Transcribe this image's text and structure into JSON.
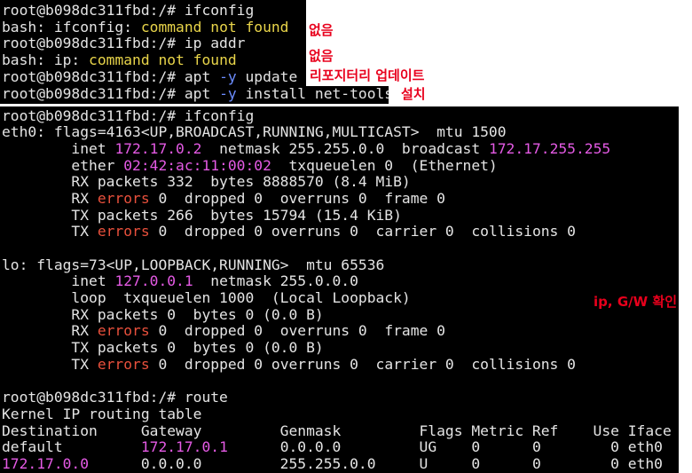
{
  "colors": {
    "terminal_bg": "#000000",
    "text": "#e4e4e4",
    "yellow": "#e9d54a",
    "magenta": "#e45ae4",
    "red": "#e8503c",
    "blue": "#6b8cff",
    "annotation": "#e8001c",
    "page_bg": "#ffffff"
  },
  "blocks": {
    "top": [
      [
        {
          "t": "root@b098dc311fbd:/# ifconfig"
        }
      ],
      [
        {
          "t": "bash: ifconfig: "
        },
        {
          "t": "command not found",
          "c": "yellow"
        }
      ],
      [
        {
          "t": "root@b098dc311fbd:/# ip addr"
        }
      ],
      [
        {
          "t": "bash: ip: "
        },
        {
          "t": "command not found",
          "c": "yellow"
        }
      ],
      [
        {
          "t": "root@b098dc311fbd:/# apt "
        },
        {
          "t": "-y",
          "c": "blue"
        },
        {
          "t": " update"
        }
      ]
    ],
    "install": [
      [
        {
          "t": "root@b098dc311fbd:/# apt "
        },
        {
          "t": "-y",
          "c": "blue"
        },
        {
          "t": " install net-tools"
        }
      ]
    ],
    "main": [
      [
        {
          "t": "root@b098dc311fbd:/# ifconfig"
        }
      ],
      [
        {
          "t": "eth0: flags=4163<UP,BROADCAST,RUNNING,MULTICAST>  mtu 1500"
        }
      ],
      [
        {
          "t": "        inet "
        },
        {
          "t": "172.17.0.2",
          "c": "magenta"
        },
        {
          "t": "  netmask 255.255.0.0  broadcast "
        },
        {
          "t": "172.17.255.255",
          "c": "magenta"
        }
      ],
      [
        {
          "t": "        ether "
        },
        {
          "t": "02:42:ac:11:00:02",
          "c": "magenta"
        },
        {
          "t": "  txqueuelen 0  (Ethernet)"
        }
      ],
      [
        {
          "t": "        RX packets 332  bytes 8888570 (8.4 MiB)"
        }
      ],
      [
        {
          "t": "        RX "
        },
        {
          "t": "errors",
          "c": "red"
        },
        {
          "t": " 0  dropped 0  overruns 0  frame 0"
        }
      ],
      [
        {
          "t": "        TX packets 266  bytes 15794 (15.4 KiB)"
        }
      ],
      [
        {
          "t": "        TX "
        },
        {
          "t": "errors",
          "c": "red"
        },
        {
          "t": " 0  dropped 0 overruns 0  carrier 0  collisions 0"
        }
      ],
      [],
      [
        {
          "t": "lo: flags=73<UP,LOOPBACK,RUNNING>  mtu 65536"
        }
      ],
      [
        {
          "t": "        inet "
        },
        {
          "t": "127.0.0.1",
          "c": "magenta"
        },
        {
          "t": "  netmask 255.0.0.0"
        }
      ],
      [
        {
          "t": "        loop  txqueuelen 1000  (Local Loopback)"
        }
      ],
      [
        {
          "t": "        RX packets 0  bytes 0 (0.0 B)"
        }
      ],
      [
        {
          "t": "        RX "
        },
        {
          "t": "errors",
          "c": "red"
        },
        {
          "t": " 0  dropped 0  overruns 0  frame 0"
        }
      ],
      [
        {
          "t": "        TX packets 0  bytes 0 (0.0 B)"
        }
      ],
      [
        {
          "t": "        TX "
        },
        {
          "t": "errors",
          "c": "red"
        },
        {
          "t": " 0  dropped 0 overruns 0  carrier 0  collisions 0"
        }
      ],
      [],
      [
        {
          "t": "root@b098dc311fbd:/# route"
        }
      ],
      [
        {
          "t": "Kernel IP routing table"
        }
      ],
      [
        {
          "t": "Destination     Gateway         Genmask         Flags Metric Ref    Use Iface"
        }
      ],
      [
        {
          "t": "default         "
        },
        {
          "t": "172.17.0.1",
          "c": "magenta"
        },
        {
          "t": "      0.0.0.0         UG    0      0        0 eth0"
        }
      ],
      [
        {
          "t": "172.17.0.0",
          "c": "magenta"
        },
        {
          "t": "      0.0.0.0         255.255.0.0     U     0      0        0 eth0"
        }
      ]
    ]
  },
  "annotations": {
    "ifconfig_missing": "없음",
    "ip_missing": "없음",
    "repo_update": "리포지터리 업데이트",
    "install": "설치",
    "check_ip_gw": "ip, G/W 확인"
  }
}
